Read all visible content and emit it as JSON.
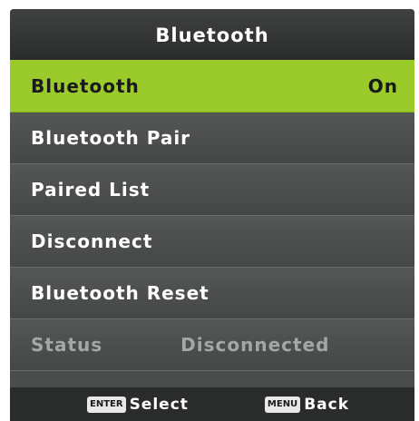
{
  "header": {
    "title": "Bluetooth"
  },
  "items": [
    {
      "label": "Bluetooth",
      "value": "On"
    },
    {
      "label": "Bluetooth Pair"
    },
    {
      "label": "Paired List"
    },
    {
      "label": "Disconnect"
    },
    {
      "label": "Bluetooth Reset"
    }
  ],
  "status": {
    "label": "Status",
    "value": "Disconnected"
  },
  "footer": {
    "select_key": "ENTER",
    "select_label": "Select",
    "back_key": "MENU",
    "back_label": "Back"
  },
  "colors": {
    "selected_bg": "#9acb2b",
    "menu_bg": "#4a4d4c",
    "header_bg": "#2a2c2b"
  }
}
